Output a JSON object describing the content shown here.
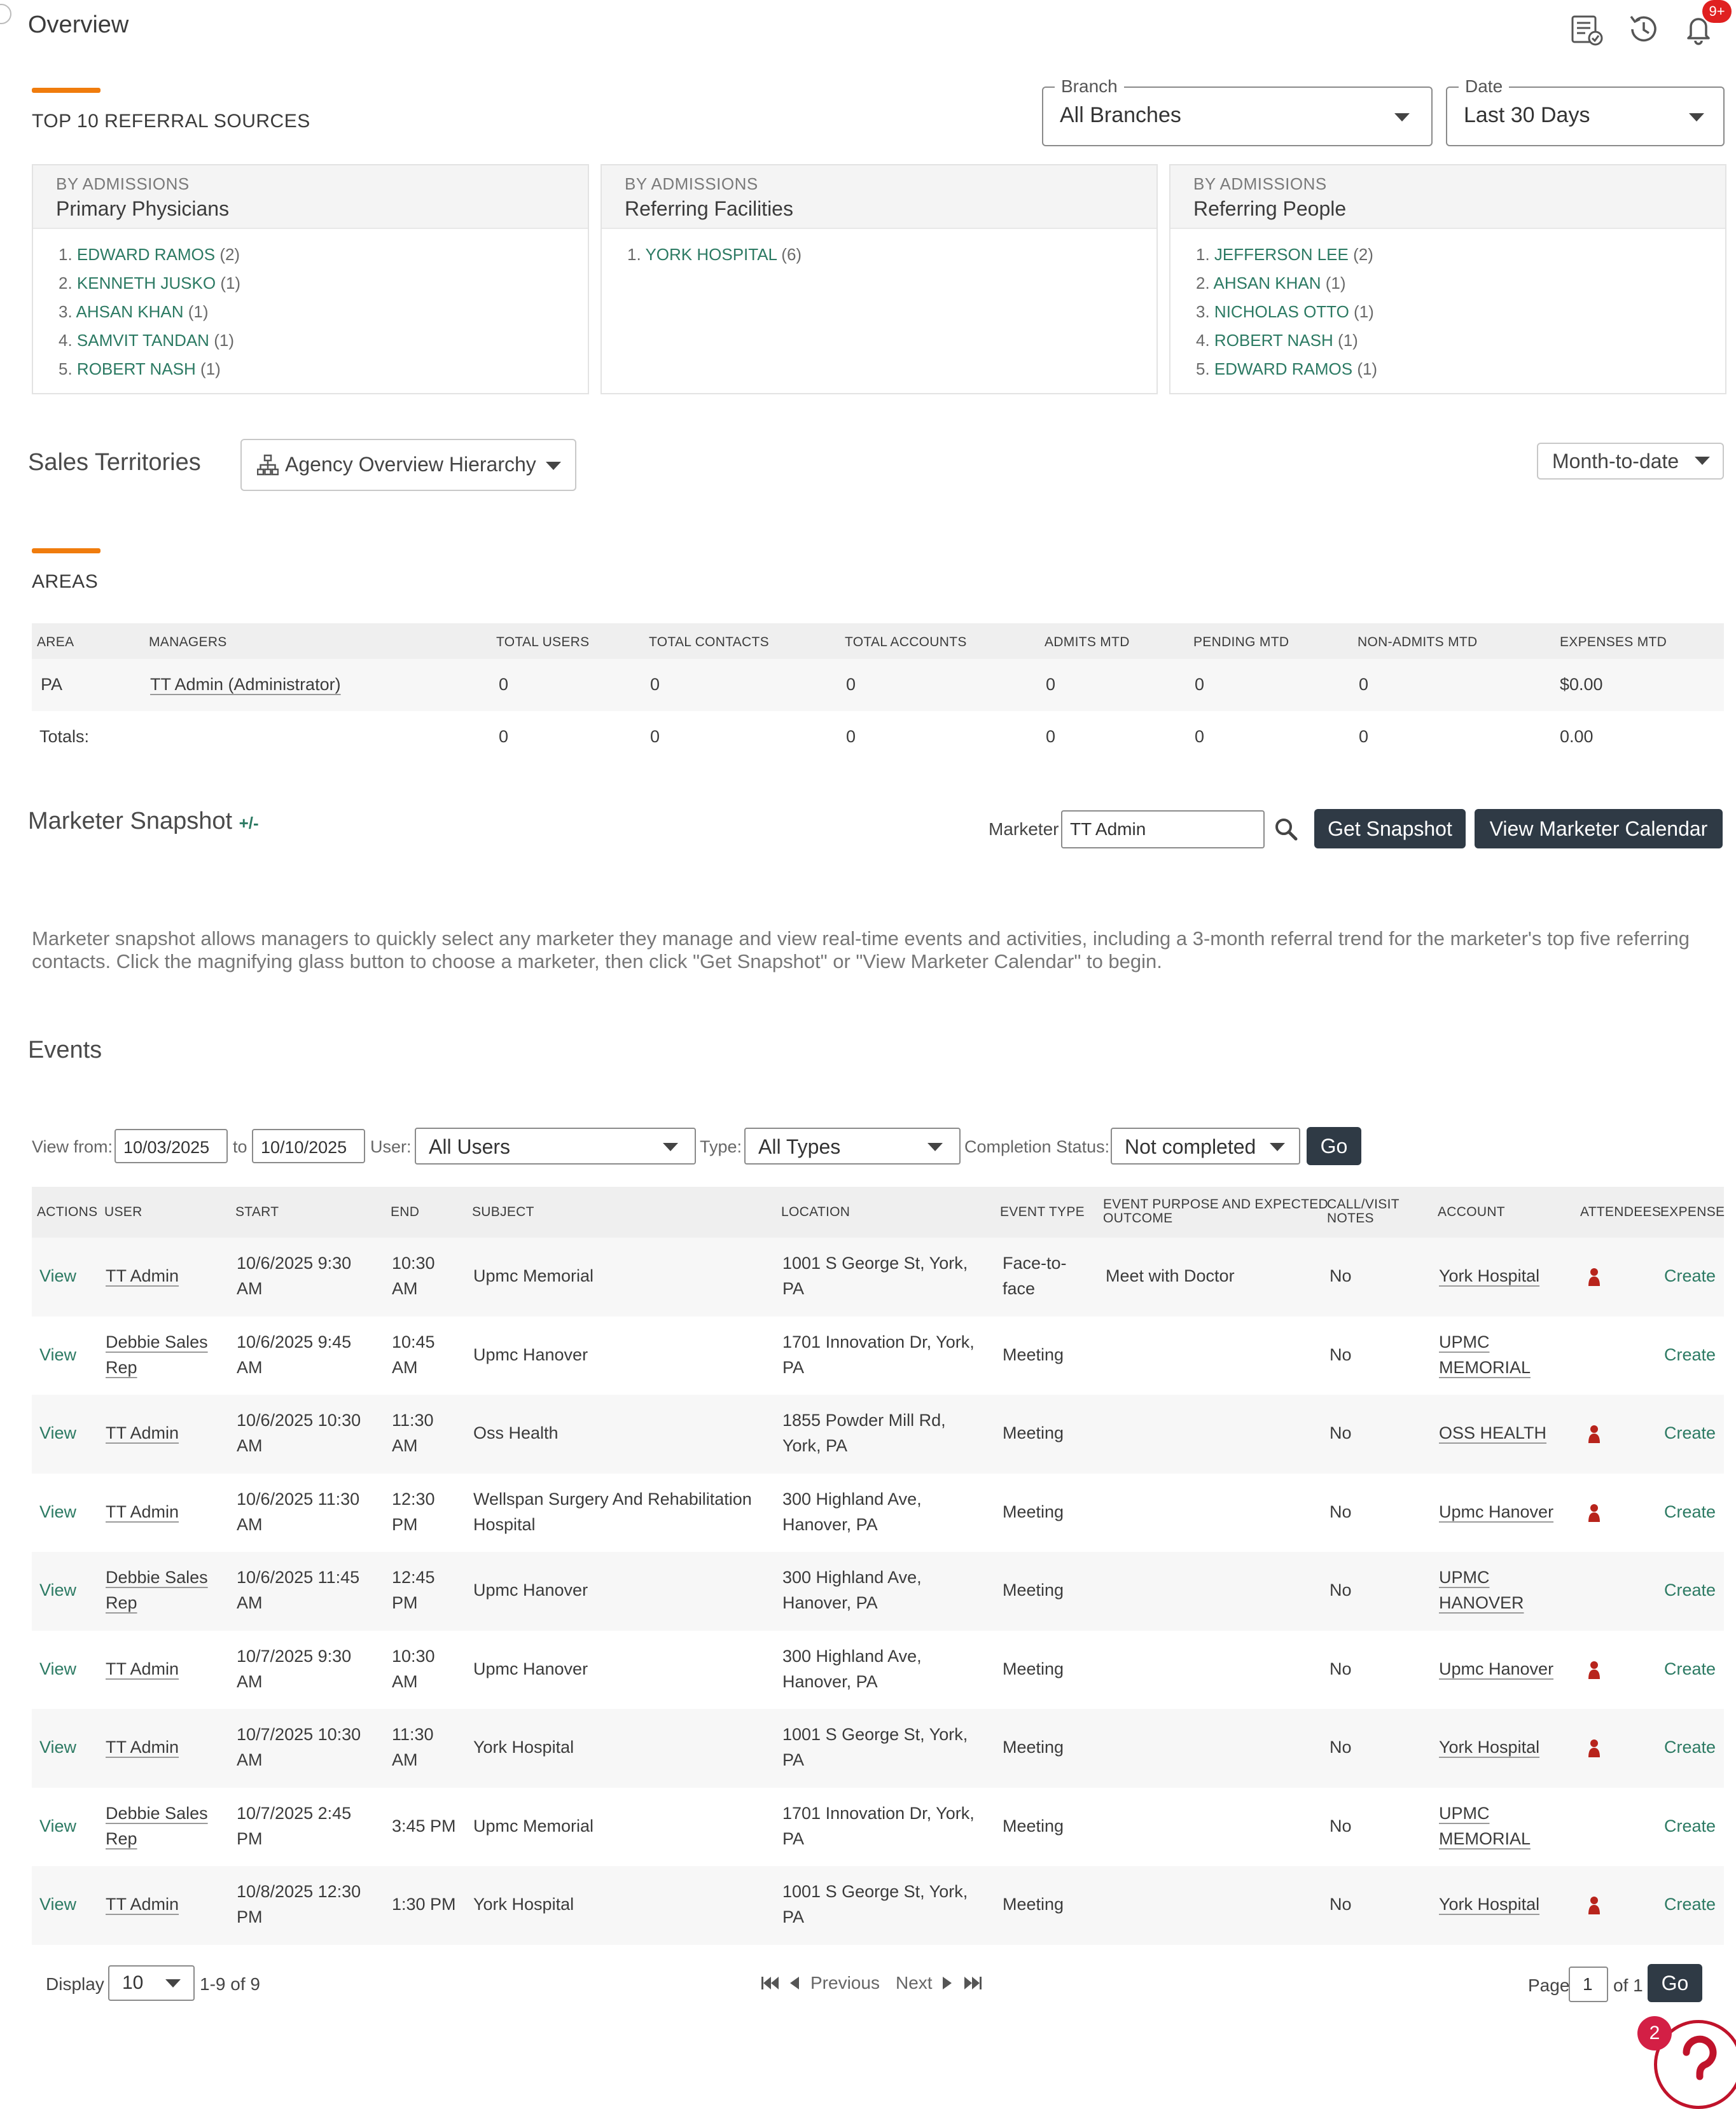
{
  "header": {
    "title": "Overview",
    "notification_badge": "9+"
  },
  "referrals": {
    "title": "TOP 10 REFERRAL SOURCES",
    "branch": {
      "legend": "Branch",
      "value": "All Branches"
    },
    "date": {
      "legend": "Date",
      "value": "Last 30 Days"
    },
    "cards": [
      {
        "sub": "BY ADMISSIONS",
        "title": "Primary Physicians",
        "items": [
          {
            "num": "1.",
            "name": "EDWARD RAMOS",
            "count": "(2)"
          },
          {
            "num": "2.",
            "name": "KENNETH JUSKO",
            "count": "(1)"
          },
          {
            "num": "3.",
            "name": "AHSAN KHAN",
            "count": "(1)"
          },
          {
            "num": "4.",
            "name": "SAMVIT TANDAN",
            "count": "(1)"
          },
          {
            "num": "5.",
            "name": "ROBERT NASH",
            "count": "(1)"
          }
        ]
      },
      {
        "sub": "BY ADMISSIONS",
        "title": "Referring Facilities",
        "items": [
          {
            "num": "1.",
            "name": "YORK HOSPITAL",
            "count": "(6)"
          }
        ]
      },
      {
        "sub": "BY ADMISSIONS",
        "title": "Referring People",
        "items": [
          {
            "num": "1.",
            "name": "JEFFERSON LEE",
            "count": "(2)"
          },
          {
            "num": "2.",
            "name": "AHSAN KHAN",
            "count": "(1)"
          },
          {
            "num": "3.",
            "name": "NICHOLAS OTTO",
            "count": "(1)"
          },
          {
            "num": "4.",
            "name": "ROBERT NASH",
            "count": "(1)"
          },
          {
            "num": "5.",
            "name": "EDWARD RAMOS",
            "count": "(1)"
          }
        ]
      }
    ]
  },
  "territories": {
    "title": "Sales Territories",
    "hierarchy": "Agency Overview Hierarchy",
    "period": "Month-to-date",
    "areas_title": "AREAS",
    "headers": [
      "AREA",
      "MANAGERS",
      "TOTAL USERS",
      "TOTAL CONTACTS",
      "TOTAL ACCOUNTS",
      "ADMITS MTD",
      "PENDING MTD",
      "NON-ADMITS MTD",
      "EXPENSES MTD"
    ],
    "row": {
      "area": "PA",
      "manager": "TT Admin (Administrator)",
      "users": "0",
      "contacts": "0",
      "accounts": "0",
      "admits": "0",
      "pending": "0",
      "nonadmits": "0",
      "expenses": "$0.00"
    },
    "totals": {
      "label": "Totals:",
      "users": "0",
      "contacts": "0",
      "accounts": "0",
      "admits": "0",
      "pending": "0",
      "nonadmits": "0",
      "expenses": "0.00"
    }
  },
  "snapshot": {
    "title": "Marketer Snapshot",
    "toggle": "+/-",
    "marketer_label": "Marketer",
    "marketer_value": "TT Admin",
    "get_snapshot": "Get Snapshot",
    "view_calendar": "View Marketer Calendar",
    "description": "Marketer snapshot allows managers to quickly select any marketer they manage and view real-time events and activities, including a 3-month referral trend for the marketer's top five referring contacts. Click the magnifying glass button to choose a marketer, then click \"Get Snapshot\" or \"View Marketer Calendar\" to begin."
  },
  "events": {
    "title": "Events",
    "filters": {
      "view_from": "View from:",
      "from": "10/03/2025",
      "to_label": "to",
      "to": "10/10/2025",
      "user_label": "User:",
      "user": "All Users",
      "type_label": "Type:",
      "type": "All Types",
      "status_label": "Completion Status:",
      "status": "Not completed",
      "go": "Go"
    },
    "headers": {
      "actions": "ACTIONS",
      "user": "USER",
      "start": "START",
      "end": "END",
      "subject": "SUBJECT",
      "location": "LOCATION",
      "type": "EVENT TYPE",
      "purpose1": "EVENT PURPOSE AND EXPECTED",
      "purpose2": "OUTCOME",
      "notes1": "CALL/VISIT",
      "notes2": "NOTES",
      "account": "ACCOUNT",
      "attendees": "ATTENDEES",
      "expense": "EXPENSE"
    },
    "rows": [
      {
        "action": "View",
        "user1": "TT Admin",
        "user2": "",
        "start1": "10/6/2025 9:30",
        "start2": "AM",
        "end1": "10:30",
        "end2": "AM",
        "subject1": "Upmc Memorial",
        "subject2": "",
        "loc1": "1001 S George St, York,",
        "loc2": "PA",
        "type1": "Face-to-",
        "type2": "face",
        "purpose": "Meet with Doctor",
        "notes": "No",
        "acct1": "York Hospital",
        "acct2": "",
        "attendee": true,
        "expense": "Create"
      },
      {
        "action": "View",
        "user1": "Debbie Sales",
        "user2": "Rep",
        "start1": "10/6/2025 9:45",
        "start2": "AM",
        "end1": "10:45",
        "end2": "AM",
        "subject1": "Upmc Hanover",
        "subject2": "",
        "loc1": "1701 Innovation Dr, York,",
        "loc2": "PA",
        "type1": "Meeting",
        "type2": "",
        "purpose": "",
        "notes": "No",
        "acct1": "UPMC",
        "acct2": "MEMORIAL",
        "attendee": false,
        "expense": "Create"
      },
      {
        "action": "View",
        "user1": "TT Admin",
        "user2": "",
        "start1": "10/6/2025 10:30",
        "start2": "AM",
        "end1": "11:30",
        "end2": "AM",
        "subject1": "Oss Health",
        "subject2": "",
        "loc1": "1855 Powder Mill Rd,",
        "loc2": "York, PA",
        "type1": "Meeting",
        "type2": "",
        "purpose": "",
        "notes": "No",
        "acct1": "OSS HEALTH",
        "acct2": "",
        "attendee": true,
        "expense": "Create"
      },
      {
        "action": "View",
        "user1": "TT Admin",
        "user2": "",
        "start1": "10/6/2025 11:30",
        "start2": "AM",
        "end1": "12:30",
        "end2": "PM",
        "subject1": "Wellspan Surgery And Rehabilitation",
        "subject2": "Hospital",
        "loc1": "300 Highland Ave,",
        "loc2": "Hanover, PA",
        "type1": "Meeting",
        "type2": "",
        "purpose": "",
        "notes": "No",
        "acct1": "Upmc Hanover",
        "acct2": "",
        "attendee": true,
        "expense": "Create"
      },
      {
        "action": "View",
        "user1": "Debbie Sales",
        "user2": "Rep",
        "start1": "10/6/2025 11:45",
        "start2": "AM",
        "end1": "12:45",
        "end2": "PM",
        "subject1": "Upmc Hanover",
        "subject2": "",
        "loc1": "300 Highland Ave,",
        "loc2": "Hanover, PA",
        "type1": "Meeting",
        "type2": "",
        "purpose": "",
        "notes": "No",
        "acct1": "UPMC",
        "acct2": "HANOVER",
        "attendee": false,
        "expense": "Create"
      },
      {
        "action": "View",
        "user1": "TT Admin",
        "user2": "",
        "start1": "10/7/2025 9:30",
        "start2": "AM",
        "end1": "10:30",
        "end2": "AM",
        "subject1": "Upmc Hanover",
        "subject2": "",
        "loc1": "300 Highland Ave,",
        "loc2": "Hanover, PA",
        "type1": "Meeting",
        "type2": "",
        "purpose": "",
        "notes": "No",
        "acct1": "Upmc Hanover",
        "acct2": "",
        "attendee": true,
        "expense": "Create"
      },
      {
        "action": "View",
        "user1": "TT Admin",
        "user2": "",
        "start1": "10/7/2025 10:30",
        "start2": "AM",
        "end1": "11:30",
        "end2": "AM",
        "subject1": "York Hospital",
        "subject2": "",
        "loc1": "1001 S George St, York,",
        "loc2": "PA",
        "type1": "Meeting",
        "type2": "",
        "purpose": "",
        "notes": "No",
        "acct1": "York Hospital",
        "acct2": "",
        "attendee": true,
        "expense": "Create"
      },
      {
        "action": "View",
        "user1": "Debbie Sales",
        "user2": "Rep",
        "start1": "10/7/2025 2:45",
        "start2": "PM",
        "end1": "3:45 PM",
        "end2": "",
        "subject1": "Upmc Memorial",
        "subject2": "",
        "loc1": "1701 Innovation Dr, York,",
        "loc2": "PA",
        "type1": "Meeting",
        "type2": "",
        "purpose": "",
        "notes": "No",
        "acct1": "UPMC",
        "acct2": "MEMORIAL",
        "attendee": false,
        "expense": "Create"
      },
      {
        "action": "View",
        "user1": "TT Admin",
        "user2": "",
        "start1": "10/8/2025 12:30",
        "start2": "PM",
        "end1": "1:30 PM",
        "end2": "",
        "subject1": "York Hospital",
        "subject2": "",
        "loc1": "1001 S George St, York,",
        "loc2": "PA",
        "type1": "Meeting",
        "type2": "",
        "purpose": "",
        "notes": "No",
        "acct1": "York Hospital",
        "acct2": "",
        "attendee": true,
        "expense": "Create"
      }
    ],
    "pager": {
      "display_label": "Display",
      "display_value": "10",
      "range": "1-9 of 9",
      "previous": "Previous",
      "next": "Next",
      "page_label": "Page",
      "page_value": "1",
      "of": "of 1",
      "go": "Go"
    }
  },
  "help": {
    "badge": "2"
  },
  "colors": {
    "accent": "#f07c0d",
    "link": "#2c7a63",
    "dark_button": "#2f3a45",
    "badge": "#e02020",
    "attendee": "#b8241c"
  }
}
